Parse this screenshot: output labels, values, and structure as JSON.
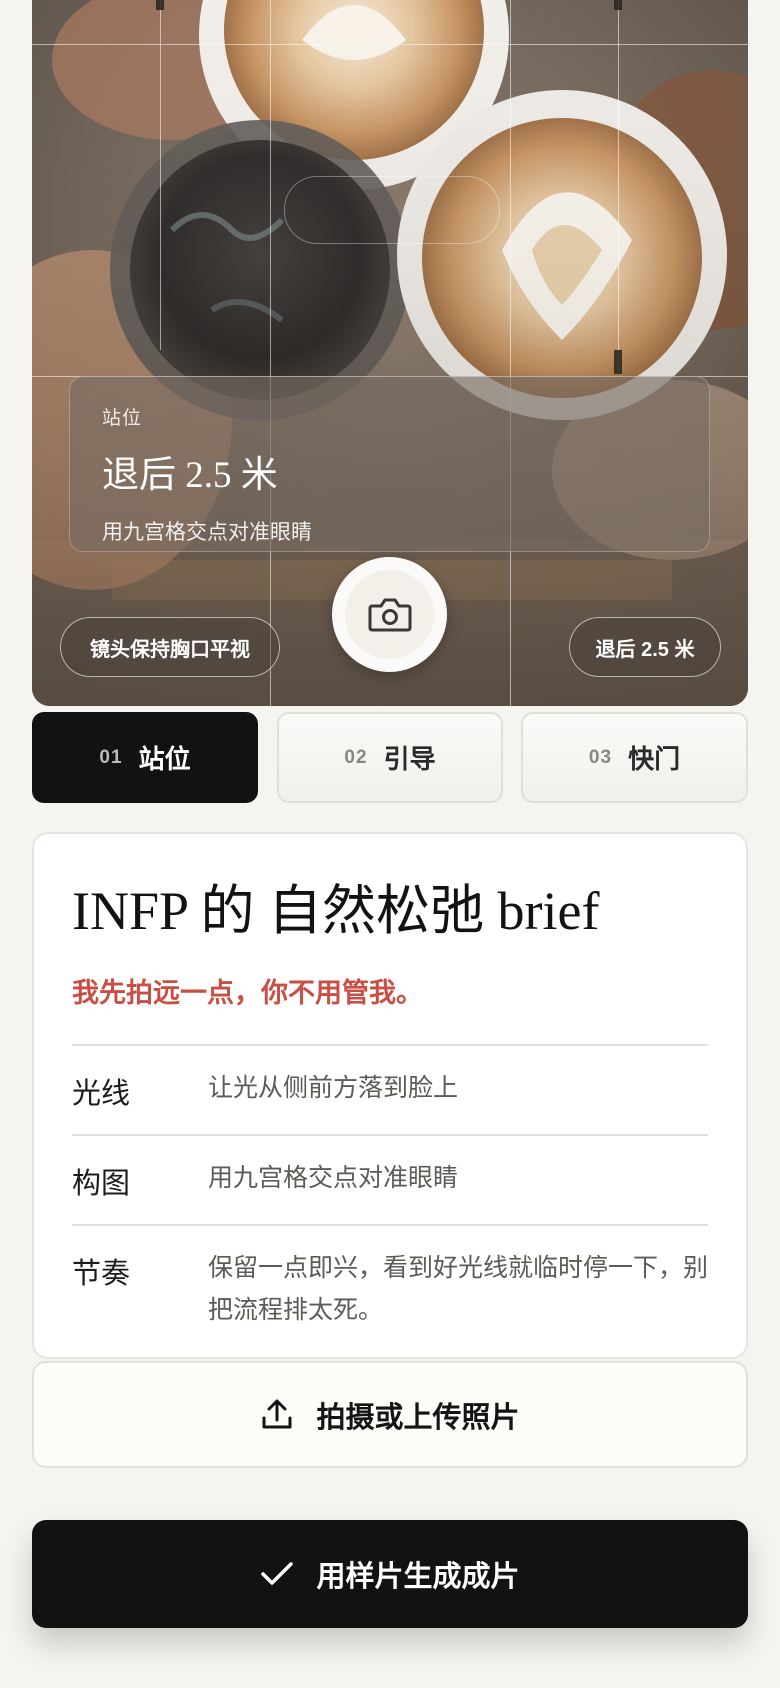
{
  "viewer": {
    "info_card": {
      "key": "站位",
      "value": "退后 2.5 米",
      "hint": "用九宫格交点对准眼睛"
    },
    "left_pill": "镜头保持胸口平视",
    "right_pill": "退后 2.5 米",
    "shutter_icon": "camera-icon"
  },
  "tabs": [
    {
      "num": "01",
      "label": "站位",
      "active": true
    },
    {
      "num": "02",
      "label": "引导",
      "active": false
    },
    {
      "num": "03",
      "label": "快门",
      "active": false
    }
  ],
  "brief": {
    "title": "INFP 的 自然松弛 brief",
    "subtitle": "我先拍远一点，你不用管我。",
    "rows": [
      {
        "label": "光线",
        "value": "让光从侧前方落到脸上"
      },
      {
        "label": "构图",
        "value": "用九宫格交点对准眼睛"
      },
      {
        "label": "节奏",
        "value": "保留一点即兴，看到好光线就临时停一下，别把流程排太死。"
      }
    ]
  },
  "actions": {
    "upload_label": "拍摄或上传照片",
    "upload_icon": "upload-icon",
    "generate_label": "用样片生成成片",
    "generate_icon": "check-icon"
  },
  "colors": {
    "accent_red": "#c94f44",
    "dark": "#121212",
    "background": "#f6f4ef"
  }
}
